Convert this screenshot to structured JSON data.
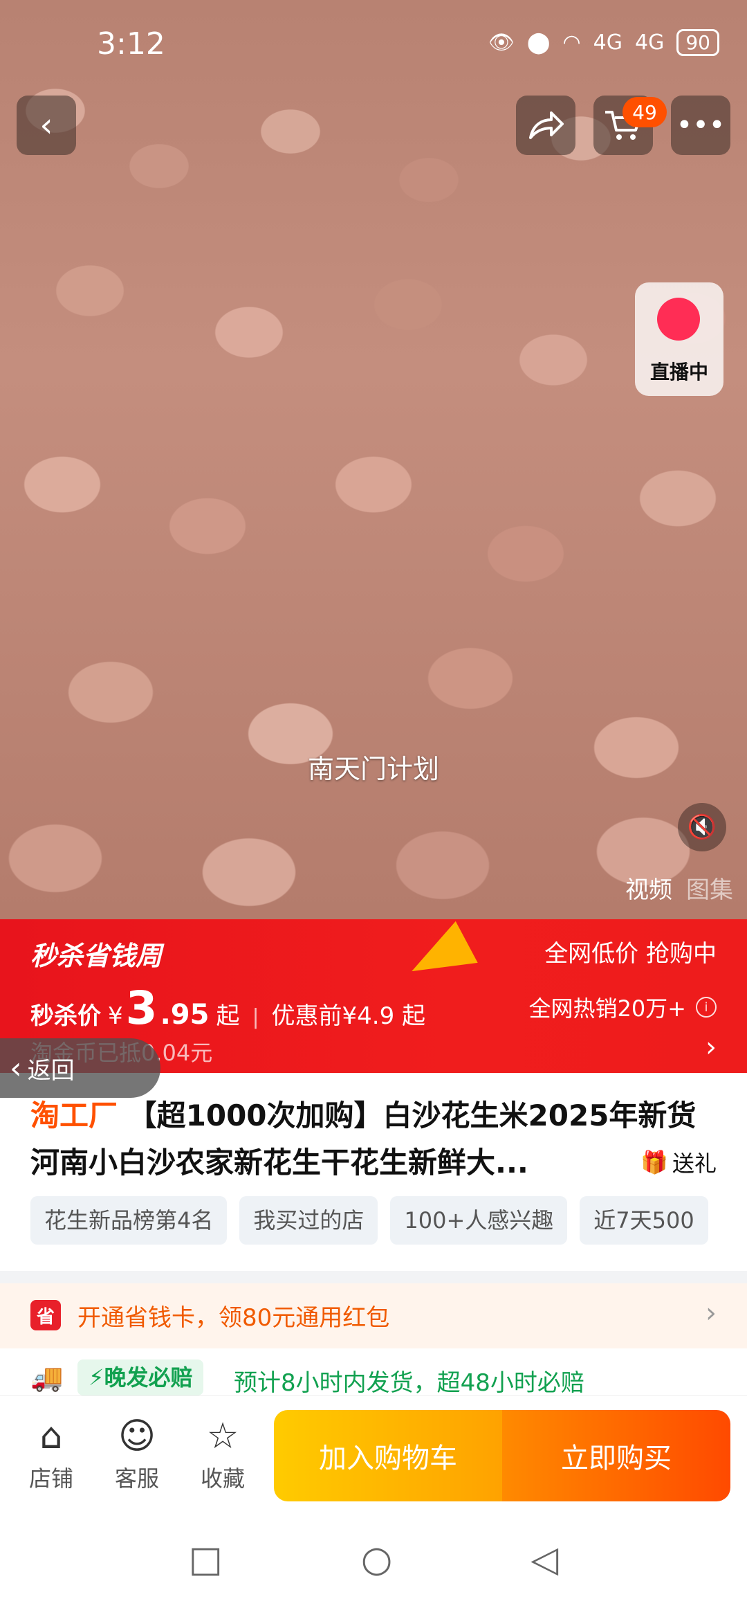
{
  "status_bar": {
    "time": "3:12",
    "signal_labels": [
      "4G",
      "4G"
    ],
    "battery": "90"
  },
  "top_bar": {
    "cart_badge": "49"
  },
  "media": {
    "live_label": "直播中",
    "subtitle": "南天门计划",
    "tabs": [
      "视频",
      "图集"
    ]
  },
  "promo": {
    "brand": "秒杀省钱周",
    "right_top": "全网低价 抢购中",
    "price_label": "秒杀价",
    "currency": "¥",
    "price_int": "3",
    "price_dec": ".95",
    "price_suffix": "起",
    "separator": "|",
    "original_price": "优惠前¥4.9 起",
    "right_bottom": "全网热销20万+",
    "coin_text": "淘金币已抵0.04元"
  },
  "back_pill": {
    "label": "返回"
  },
  "product": {
    "factory": "淘工厂",
    "title": "【超1000次加购】白沙花生米2025年新货河南小白沙农家新花生干花生新鲜大...",
    "gift": "送礼",
    "tags": [
      "花生新品榜第4名",
      "我买过的店",
      "100+人感兴趣",
      "近7天500"
    ]
  },
  "saver": {
    "icon_text": "省",
    "text": "开通省钱卡，领80元通用红包"
  },
  "shipping": {
    "badge": "晚发必赔",
    "text": "预计8小时内发货，超48小时必赔"
  },
  "actions": {
    "shop": "店铺",
    "service": "客服",
    "favorite": "收藏",
    "add_to_cart": "加入购物车",
    "buy_now": "立即购买"
  },
  "colors": {
    "accent": "#ff5000",
    "promo_red": "#ee1c1c",
    "ship_green": "#12a150"
  }
}
